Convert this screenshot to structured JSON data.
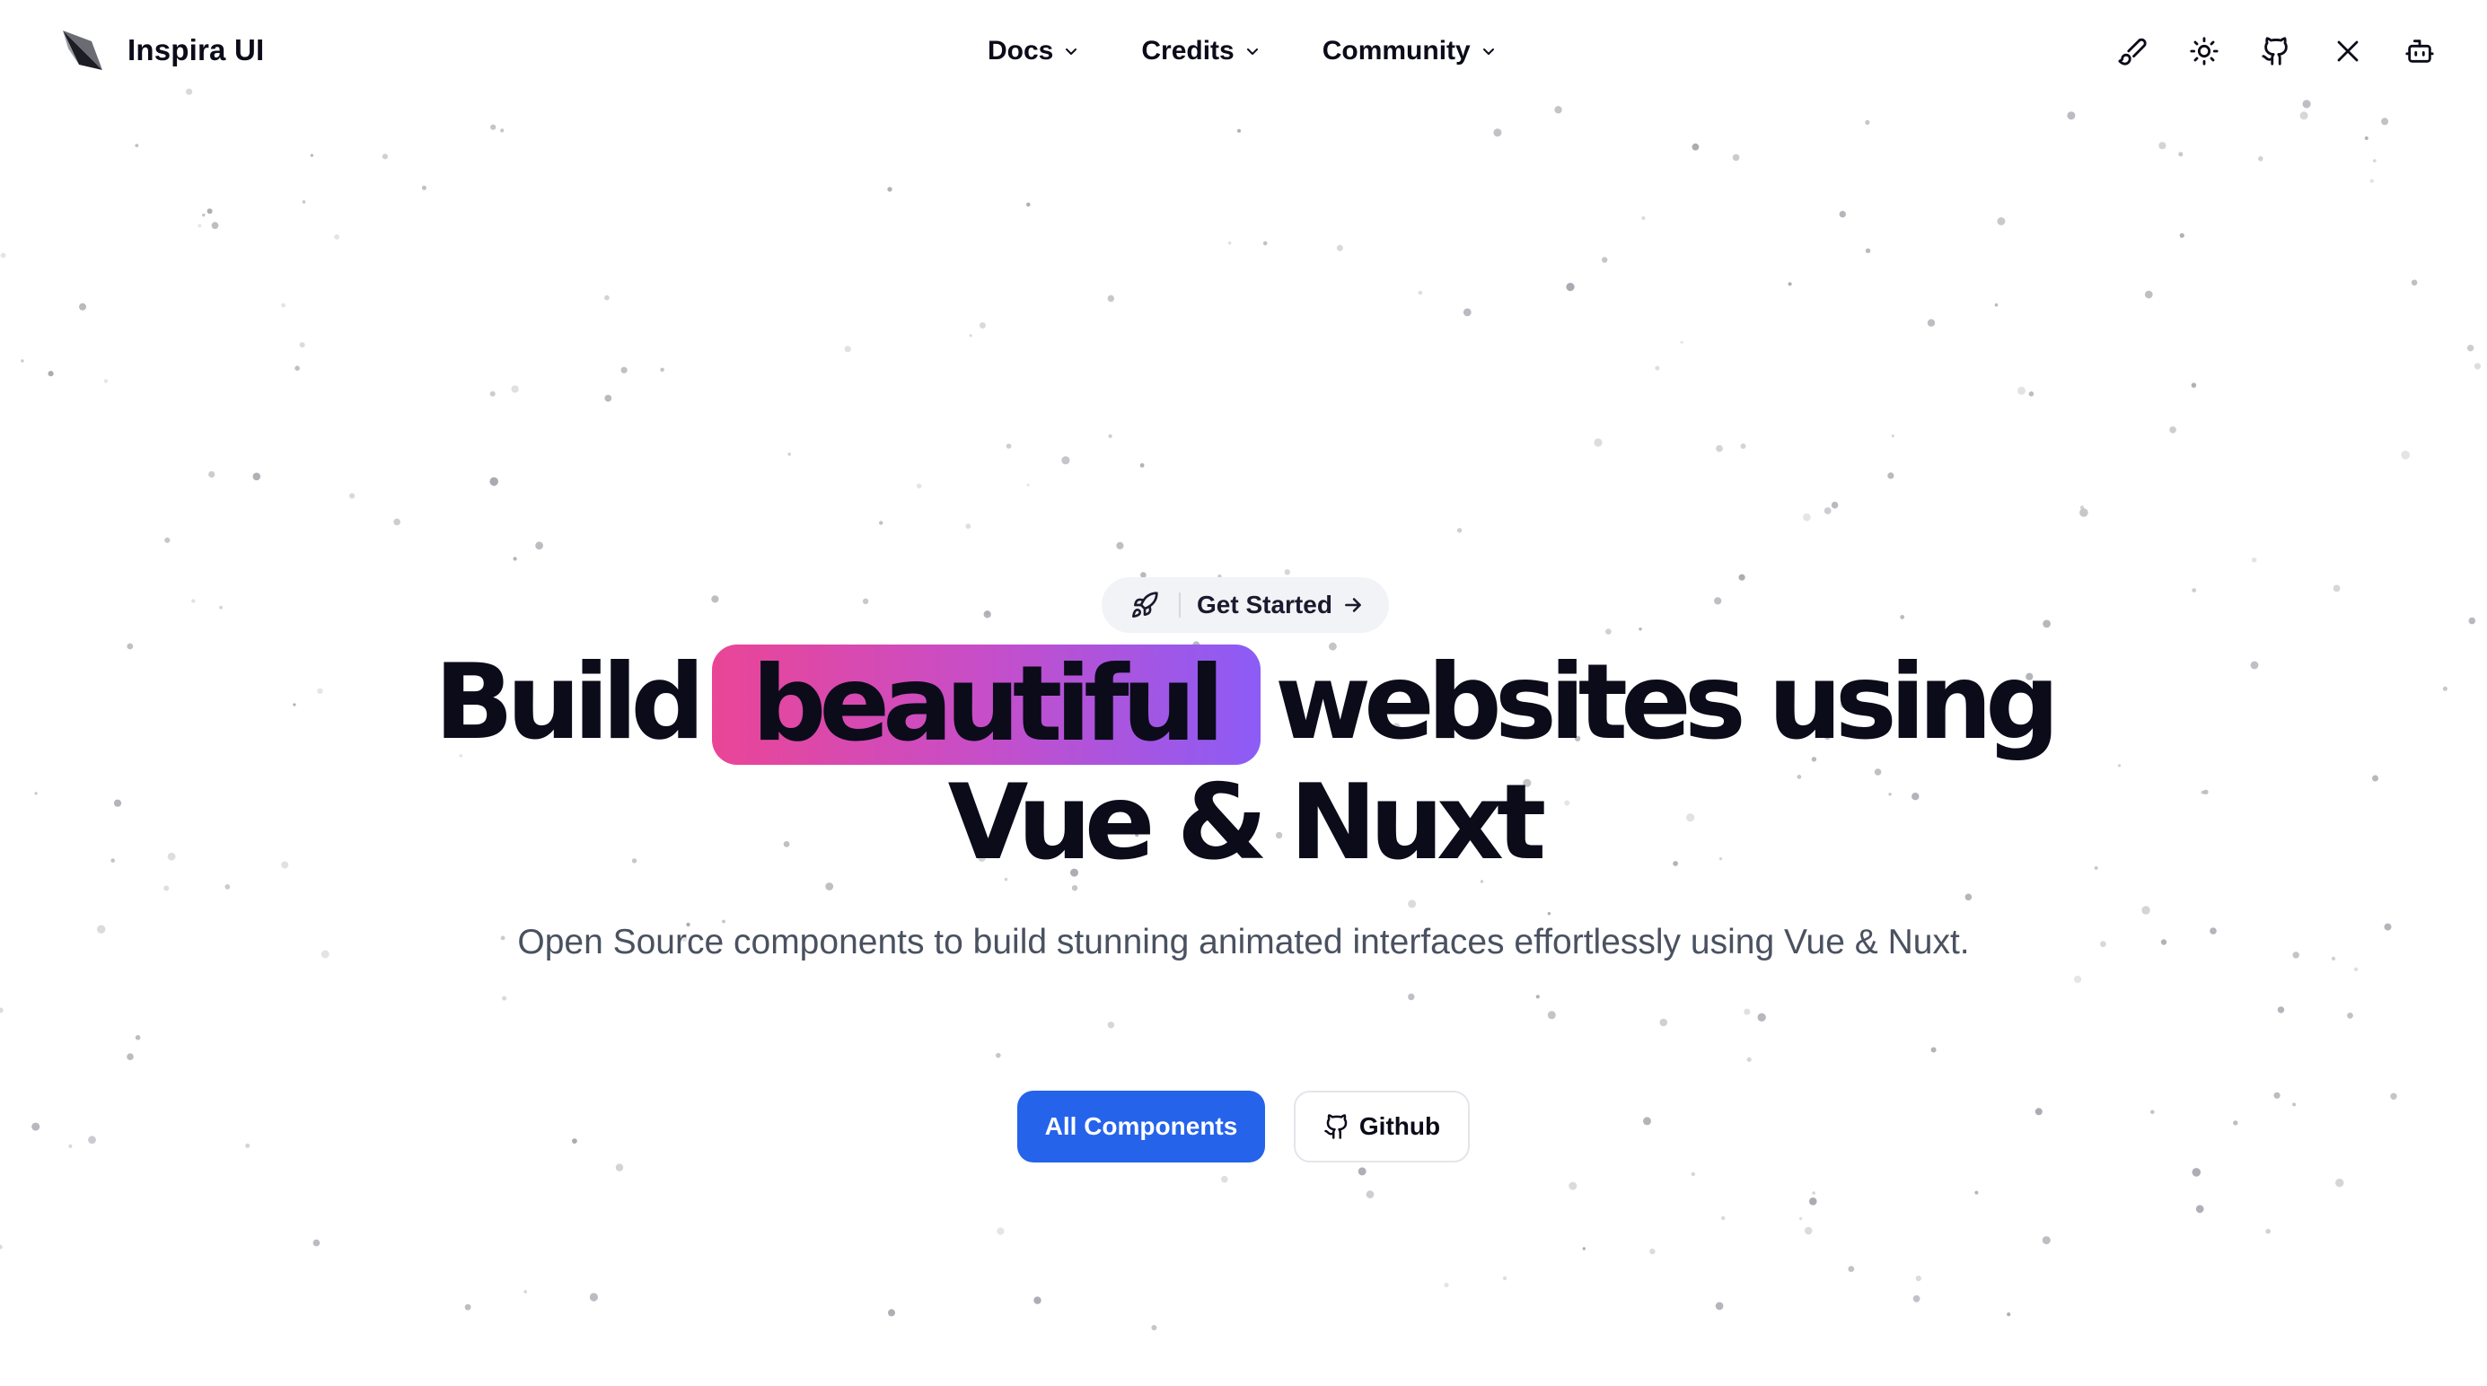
{
  "brand": {
    "name": "Inspira UI"
  },
  "nav": {
    "items": [
      {
        "label": "Docs"
      },
      {
        "label": "Credits"
      },
      {
        "label": "Community"
      }
    ]
  },
  "header_icons": [
    "paintbrush-icon",
    "sun-icon",
    "github-icon",
    "x-icon",
    "bot-icon"
  ],
  "hero": {
    "pill_label": "Get Started",
    "headline_before": "Build",
    "headline_highlight": "beautiful",
    "headline_after": "websites using",
    "headline_line2": "Vue & Nuxt",
    "subtitle": "Open Source components to build stunning animated interfaces effortlessly using Vue & Nuxt.",
    "primary_button": "All Components",
    "secondary_button": "Github"
  },
  "colors": {
    "primary": "#2563eb",
    "gradient_start": "#ea4596",
    "gradient_end": "#8b5cf6",
    "text": "#0b0b1a",
    "muted": "#4a5160"
  }
}
